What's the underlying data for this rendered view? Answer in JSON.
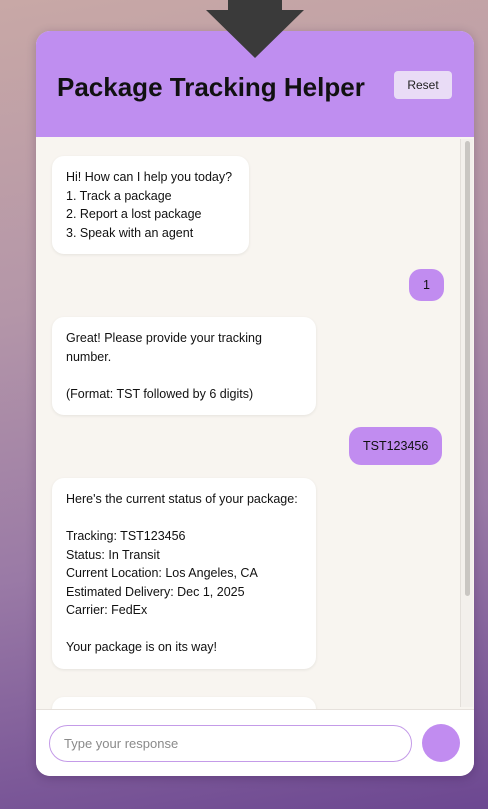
{
  "header": {
    "title": "Package Tracking Helper",
    "reset_label": "Reset"
  },
  "messages": [
    {
      "sender": "bot",
      "text": "Hi! How can I help you today?\n1. Track a package\n2. Report a lost package\n3. Speak with an agent"
    },
    {
      "sender": "user",
      "text": "1"
    },
    {
      "sender": "bot",
      "text": "Great! Please provide your tracking number.\n\n(Format: TST followed by 6 digits)"
    },
    {
      "sender": "user",
      "text": "TST123456"
    },
    {
      "sender": "bot",
      "text": "Here's the current status of your package:\n\nTracking: TST123456\nStatus: In Transit\nCurrent Location: Los Angeles, CA\nEstimated Delivery: Dec 1, 2025\nCarrier: FedEx\n\nYour package is on its way!"
    },
    {
      "sender": "bot",
      "text": ""
    }
  ],
  "input": {
    "placeholder": "Type your response",
    "value": ""
  },
  "colors": {
    "accent": "#bf8ef0",
    "user_bubble": "#c18cf0",
    "panel_bg": "#f8f5f0",
    "arrow": "#3a3a3a"
  }
}
